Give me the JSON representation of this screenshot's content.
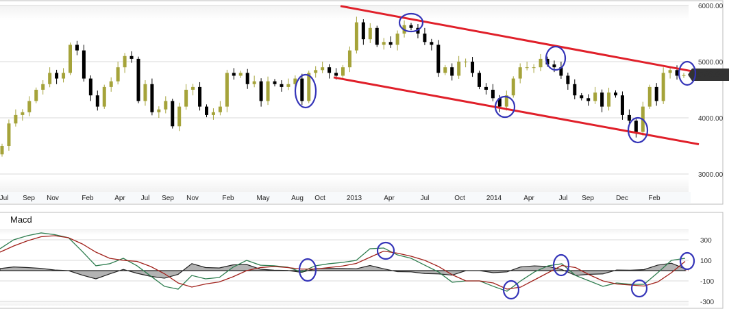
{
  "chart_data": [
    {
      "type": "candlestick",
      "title": "",
      "yticks": [
        "6000.00",
        "5000.00",
        "4000.00",
        "3000.00"
      ],
      "ytick_values": [
        6000,
        5000,
        4000,
        3000
      ],
      "ylim": [
        2700,
        6000
      ],
      "xticks": [
        "Jul",
        "Sep",
        "Nov",
        "Feb",
        "Apr",
        "Jul",
        "Sep",
        "Nov",
        "Feb",
        "May",
        "Aug",
        "Oct",
        "2013",
        "Apr",
        "Jul",
        "Oct",
        "2014",
        "Apr",
        "Jul",
        "Sep",
        "Dec",
        "Feb"
      ],
      "xtick_index": [
        0.6,
        4.2,
        7.7,
        12.8,
        17.5,
        21.2,
        24.5,
        28.1,
        33.3,
        38.4,
        43.4,
        46.7,
        51.7,
        56.8,
        62,
        67.1,
        72.1,
        77.2,
        82.2,
        85.8,
        90.8,
        95.5
      ],
      "last_price": "4760.00",
      "closes": [
        3500,
        3900,
        4050,
        4100,
        4300,
        4500,
        4600,
        4800,
        4700,
        4800,
        5300,
        5200,
        4700,
        4400,
        4200,
        4550,
        4650,
        4900,
        5100,
        5050,
        4300,
        4600,
        4100,
        4150,
        4300,
        3850,
        4200,
        4500,
        4550,
        4200,
        4050,
        4100,
        4200,
        4800,
        4750,
        4800,
        4600,
        4650,
        4300,
        4650,
        4600,
        4550,
        4600,
        4700,
        4300,
        4800,
        4850,
        4900,
        4800,
        4750,
        4900,
        5200,
        5700,
        5400,
        5600,
        5300,
        5350,
        5300,
        5500,
        5650,
        5600,
        5500,
        5350,
        5300,
        4800,
        4900,
        4750,
        5000,
        5000,
        4800,
        4550,
        4500,
        4350,
        4200,
        4400,
        4700,
        4900,
        4900,
        4900,
        5050,
        4950,
        4900,
        4750,
        4600,
        4400,
        4350,
        4300,
        4450,
        4200,
        4450,
        4400,
        4050,
        3950,
        3750,
        4200,
        4550,
        4300,
        4800,
        4850,
        4750,
        4760
      ],
      "up_color": "#a5a33a",
      "down_color": "#000000",
      "trendlines": [
        {
          "name": "upper-channel",
          "from": [
            49.7,
            5990
          ],
          "to": [
            101,
            4830
          ],
          "color": "#e0202a"
        },
        {
          "name": "lower-channel",
          "from": [
            48.7,
            4720
          ],
          "to": [
            102,
            3530
          ],
          "color": "#e0202a"
        }
      ]
    },
    {
      "type": "line",
      "title": "Macd",
      "yticks": [
        "300",
        "100",
        "-100",
        "-300"
      ],
      "ytick_values": [
        300,
        100,
        -100,
        -300
      ],
      "step_index": 2,
      "macd": [
        213,
        300,
        340,
        367,
        350,
        320,
        187,
        47,
        67,
        120,
        47,
        -53,
        -153,
        -180,
        -47,
        -80,
        -67,
        33,
        100,
        53,
        47,
        33,
        -13,
        47,
        67,
        80,
        100,
        213,
        220,
        153,
        120,
        53,
        -13,
        -113,
        -100,
        -100,
        -153,
        -200,
        -100,
        -13,
        47,
        67,
        -47,
        -100,
        -153,
        -120,
        -133,
        -133,
        -20,
        100,
        120
      ],
      "signal": [
        180,
        240,
        290,
        330,
        340,
        320,
        260,
        180,
        120,
        100,
        90,
        40,
        -30,
        -120,
        -160,
        -130,
        -110,
        -60,
        0,
        30,
        40,
        30,
        15,
        15,
        30,
        45,
        70,
        130,
        190,
        170,
        140,
        100,
        40,
        -40,
        -100,
        -100,
        -120,
        -180,
        -160,
        -90,
        -20,
        50,
        30,
        -40,
        -100,
        -130,
        -140,
        -150,
        -110,
        -20,
        90
      ],
      "macd_color": "#2e7d4f",
      "signal_color": "#a0201a",
      "hist_color": "#999999"
    }
  ]
}
